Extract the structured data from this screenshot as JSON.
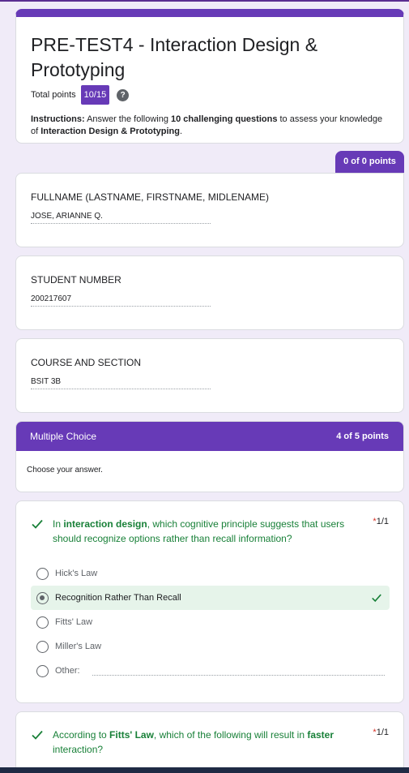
{
  "form": {
    "title": "PRE-TEST4 - Interaction Design & Prototyping",
    "total_points_label": "Total points",
    "total_points_value": "10/15",
    "help_icon": "help-icon",
    "instructions_prefix": "Instructions:",
    "instructions_part1": " Answer the following ",
    "instructions_bold1": "10 challenging questions",
    "instructions_part2": " to assess your knowledge of ",
    "instructions_bold2": "Interaction Design & Prototyping",
    "instructions_end": "."
  },
  "info_points": "0 of 0 points",
  "fields": [
    {
      "label": "FULLNAME (LASTNAME, FIRSTNAME, MIDLENAME)",
      "value": "JOSE, ARIANNE Q."
    },
    {
      "label": "STUDENT NUMBER",
      "value": "200217607"
    },
    {
      "label": "COURSE AND SECTION",
      "value": "BSIT 3B"
    }
  ],
  "section": {
    "title": "Multiple Choice",
    "points": "4 of 5 points",
    "description": "Choose your answer."
  },
  "q1": {
    "text_before": "In ",
    "text_bold": "interaction design",
    "text_after": ", which cognitive principle suggests that users should recognize options rather than recall information?",
    "required": "*",
    "score": "1/1",
    "options": [
      "Hick's Law",
      "Recognition Rather Than Recall",
      "Fitts' Law",
      "Miller's Law",
      "Other:"
    ],
    "selected_index": 1
  },
  "q2": {
    "text_before": "According to ",
    "text_bold": "Fitts' Law",
    "text_mid": ", which of the following will result in ",
    "text_bold2": "faster",
    "text_after": " interaction?",
    "required": "*",
    "score": "1/1"
  },
  "colors": {
    "accent": "#673ab7",
    "correct": "#188038",
    "correct_bg": "#e6f4ea",
    "required": "#d93025",
    "background": "#f0ebf8"
  }
}
